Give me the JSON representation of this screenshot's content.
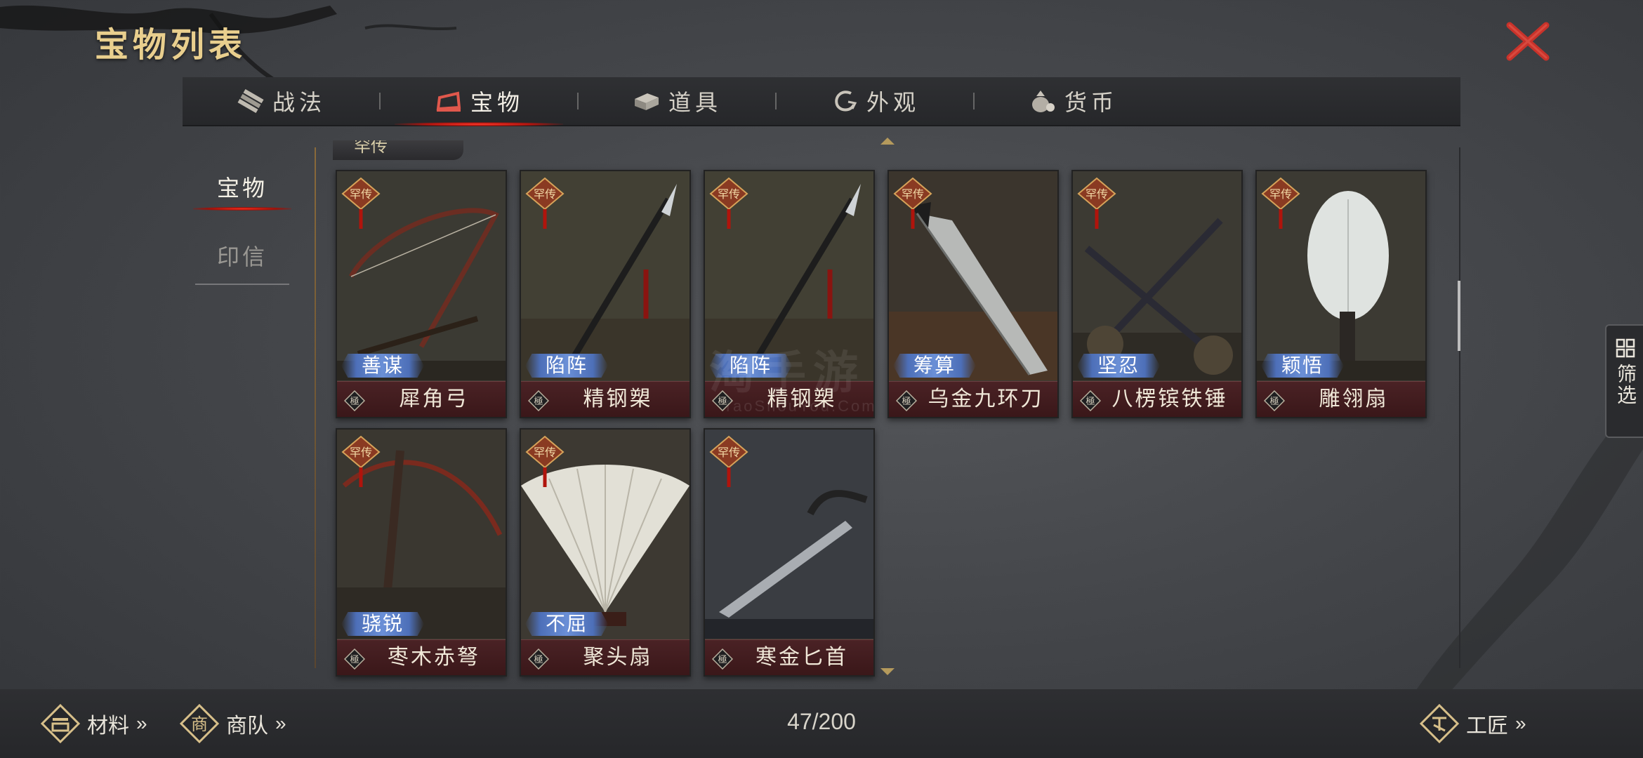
{
  "header": {
    "title": "宝物列表"
  },
  "tabs": [
    {
      "label": "战法",
      "icon": "scroll-bundle-icon",
      "active": false
    },
    {
      "label": "宝物",
      "icon": "treasure-chest-icon",
      "active": true
    },
    {
      "label": "道具",
      "icon": "item-box-icon",
      "active": false
    },
    {
      "label": "外观",
      "icon": "appearance-swirl-icon",
      "active": false
    },
    {
      "label": "货币",
      "icon": "coin-bag-icon",
      "active": false
    }
  ],
  "side": {
    "items": [
      "宝物",
      "印信"
    ]
  },
  "group_label": "罕传",
  "rarity_tag": "罕传",
  "grade_tag": "極",
  "cards": [
    {
      "name": "犀角弓",
      "trait": "善谋",
      "art": "bow"
    },
    {
      "name": "精钢槊",
      "trait": "陷阵",
      "art": "spear"
    },
    {
      "name": "精钢槊",
      "trait": "陷阵",
      "art": "spear"
    },
    {
      "name": "乌金九环刀",
      "trait": "筹算",
      "art": "blade"
    },
    {
      "name": "八楞镔铁锤",
      "trait": "坚忍",
      "art": "hammers"
    },
    {
      "name": "雕翎扇",
      "trait": "颖悟",
      "art": "feather-fan"
    },
    {
      "name": "枣木赤弩",
      "trait": "骁锐",
      "art": "crossbow"
    },
    {
      "name": "聚头扇",
      "trait": "不屈",
      "art": "folding-fan"
    },
    {
      "name": "寒金匕首",
      "trait": "",
      "art": "dagger"
    }
  ],
  "bottom": {
    "materials_label": "材料",
    "caravan_label": "商队",
    "caravan_badge": "商",
    "craftsman_label": "工匠",
    "count": "47/200"
  },
  "filter_label": "筛选",
  "watermark": {
    "text": "淘手游",
    "sub": "TaoShouYou.Com"
  },
  "colors": {
    "title_gold": "#e9cf8e",
    "tab_active_red": "#ff3b2c",
    "close_red": "#c8322a",
    "trait_blue": "#5a7cc6"
  }
}
